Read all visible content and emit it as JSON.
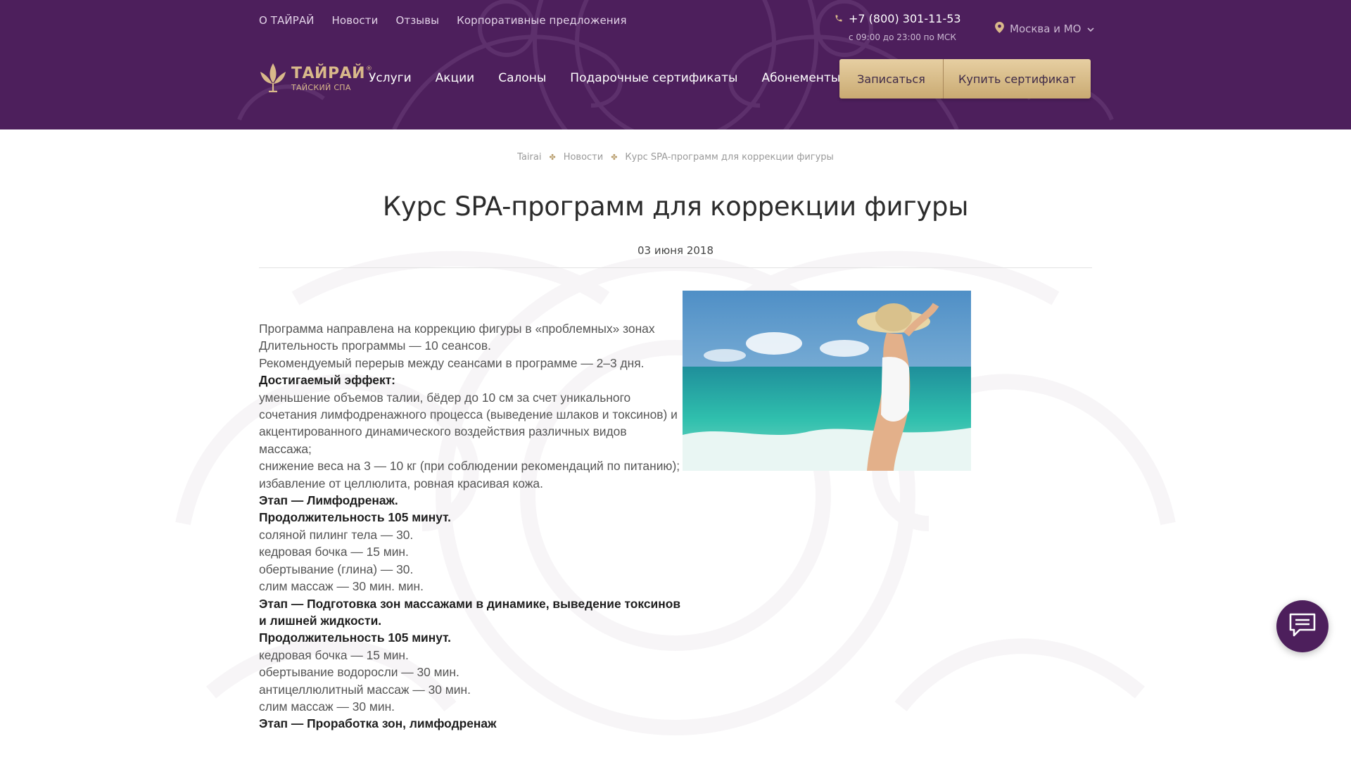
{
  "colors": {
    "header_bg": "#4d1f5c",
    "accent_gold": "#d9b98a",
    "button_gold": "#dcc08f"
  },
  "top_nav": [
    "О ТАЙРАЙ",
    "Новости",
    "Отзывы",
    "Корпоративные предложения"
  ],
  "contact": {
    "phone": "+7 (800) 301-11-53",
    "hours": "с 09:00 до 23:00 по МСК",
    "phone_icon": "phone-icon"
  },
  "city": {
    "selected": "Москва и МО",
    "icon": "location-pin-icon"
  },
  "logo": {
    "title": "ТАЙРАЙ",
    "registered": "®",
    "subtitle": "ТАЙСКИЙ СПА"
  },
  "main_nav": [
    "Услуги",
    "Акции",
    "Салоны",
    "Подарочные сертификаты",
    "Абонементы"
  ],
  "buttons": {
    "book": "Записаться",
    "buy_certificate": "Купить сертификат"
  },
  "breadcrumb": [
    "Tairai",
    "Новости",
    "Курс SPA-программ для коррекции фигуры"
  ],
  "article": {
    "title": "Курс SPA-программ для коррекции фигуры",
    "date": "03 июня 2018",
    "paragraphs": [
      "Программа направлена на коррекцию фигуры в «проблемных» зонах",
      "Длительность программы — 10 сеансов.",
      "Рекомендуемый перерыв между сеансами в программе — 2–3 дня.",
      "Достигаемый эффект:",
      "уменьшение объемов талии, бёдер до 10 см за счет уникального сочетания лимфодренажного процесса (выведение шлаков и токсинов) и акцентированного динамического воздействия различных видов массажа;",
      "снижение веса на 3 — 10 кг (при соблюдении рекомендаций по питанию);",
      "избавление от целлюлита, ровная красивая кожа.",
      "Этап — Лимфодренаж.",
      "Продолжительность 105 минут.",
      "соляной пилинг тела — 30.",
      "кедровая бочка — 15 мин.",
      "обертывание (глина) — 30.",
      "слим массаж — 30 мин. мин.",
      "Этап — Подготовка зон массажами в динамике, выведение токсинов и лишней жидкости.",
      "Продолжительность 105 минут.",
      "кедровая бочка — 15 мин.",
      "обертывание водоросли — 30 мин.",
      "антицеллюлитный массаж — 30 мин.",
      "слим массаж — 30 мин.",
      "Этап — Проработка зон, лимфодренаж"
    ]
  },
  "chat": {
    "icon": "chat-bubble-icon"
  }
}
